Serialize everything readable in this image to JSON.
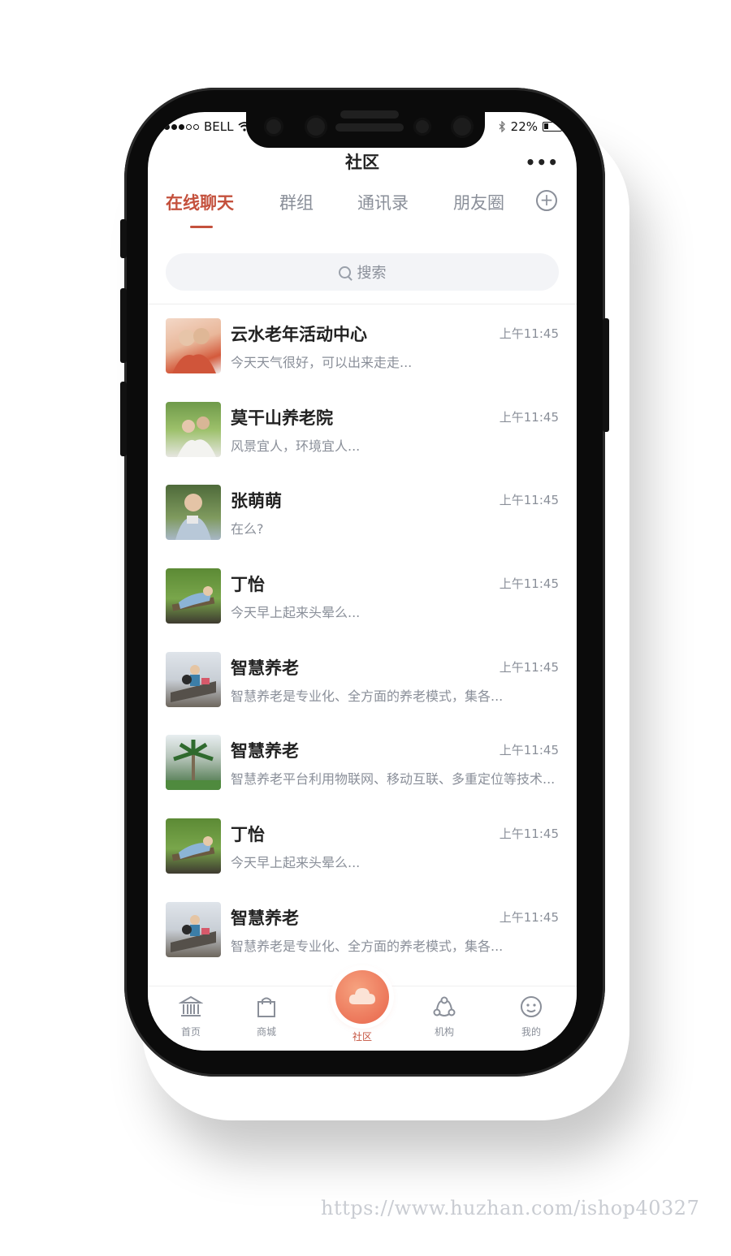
{
  "status_bar": {
    "carrier": "BELL",
    "battery": "22%"
  },
  "header": {
    "title": "社区",
    "more_icon": "more-dots-icon"
  },
  "tabs": [
    {
      "label": "在线聊天",
      "active": true
    },
    {
      "label": "群组",
      "active": false
    },
    {
      "label": "通讯录",
      "active": false
    },
    {
      "label": "朋友圈",
      "active": false
    }
  ],
  "search": {
    "placeholder": "搜索"
  },
  "chats": [
    {
      "name": "云水老年活动中心",
      "message": "今天天气很好，可以出来走走...",
      "time": "上午11:45"
    },
    {
      "name": "莫干山养老院",
      "message": "风景宜人，环境宜人...",
      "time": "上午11:45"
    },
    {
      "name": "张萌萌",
      "message": "在么?",
      "time": "上午11:45"
    },
    {
      "name": "丁怡",
      "message": "今天早上起来头晕么...",
      "time": "上午11:45"
    },
    {
      "name": "智慧养老",
      "message": "智慧养老是专业化、全方面的养老模式，集各...",
      "time": "上午11:45"
    },
    {
      "name": "智慧养老",
      "message": "智慧养老平台利用物联网、移动互联、多重定位等技术...",
      "time": "上午11:45"
    },
    {
      "name": "丁怡",
      "message": "今天早上起来头晕么...",
      "time": "上午11:45"
    },
    {
      "name": "智慧养老",
      "message": "智慧养老是专业化、全方面的养老模式，集各...",
      "time": "上午11:45"
    }
  ],
  "tabbar": [
    {
      "label": "首页",
      "icon": "bank-icon"
    },
    {
      "label": "商城",
      "icon": "shopping-bag-icon"
    },
    {
      "label": "社区",
      "icon": "cloud-chat-icon",
      "active": true
    },
    {
      "label": "机构",
      "icon": "network-icon"
    },
    {
      "label": "我的",
      "icon": "smile-icon"
    }
  ],
  "watermark": "https://www.huzhan.com/ishop40327",
  "colors": {
    "accent": "#c4513d",
    "muted": "#8a8f99",
    "center_button": "#e8644a"
  }
}
